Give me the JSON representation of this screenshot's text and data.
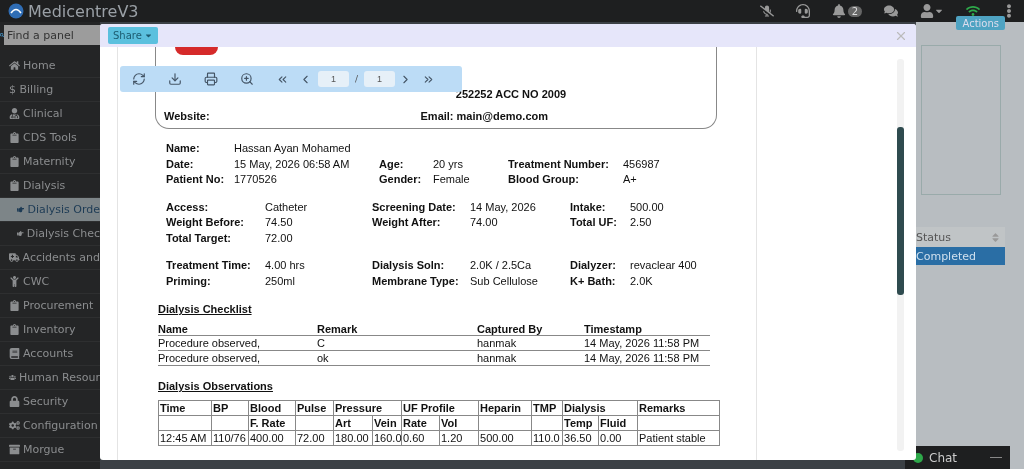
{
  "topbar": {
    "brand": "MedicentreV3",
    "notifications": "2"
  },
  "sidebar": {
    "search": {
      "placeholder": "Find a panel"
    },
    "items": [
      {
        "label": "Home",
        "selected": false
      },
      {
        "label": "$ Billing",
        "selected": false
      },
      {
        "label": "Clinical",
        "selected": false
      },
      {
        "label": "CDS Tools",
        "selected": false
      },
      {
        "label": "Maternity",
        "selected": false
      },
      {
        "label": "Dialysis",
        "selected": false,
        "expanded": true,
        "children": [
          {
            "label": "Dialysis Orde",
            "selected": true
          },
          {
            "label": "Dialysis Chec",
            "selected": false
          }
        ]
      },
      {
        "label": "Accidents and",
        "selected": false
      },
      {
        "label": "CWC",
        "selected": false
      },
      {
        "label": "Procurement",
        "selected": false
      },
      {
        "label": "Inventory",
        "selected": false
      },
      {
        "label": "Accounts",
        "selected": false
      },
      {
        "label": "Human Resour",
        "selected": false
      },
      {
        "label": "Security",
        "selected": false
      },
      {
        "label": "Configuration",
        "selected": false
      },
      {
        "label": "Morgue",
        "selected": false
      }
    ]
  },
  "background": {
    "actions": "Actions",
    "table": {
      "column": "Status",
      "cell": "Completed"
    }
  },
  "chat": {
    "label": "Chat",
    "online": true
  },
  "modal": {
    "share": "Share",
    "viewer": {
      "page": "1",
      "separator": "/",
      "pages": "1"
    },
    "document": {
      "header": {
        "contact": "252252 ACC NO 2009",
        "website": "Website:",
        "email": "Email: main@demo.com"
      },
      "sections": [
        [
          [
            [
              "Name:",
              "Hassan Ayan Mohamed"
            ]
          ],
          [
            [
              "Date:",
              "15 May, 2026 06:58 AM"
            ],
            [
              "Age:",
              "20 yrs"
            ],
            [
              "Treatment Number:",
              "456987"
            ]
          ],
          [
            [
              "Patient No:",
              "1770526"
            ],
            [
              "Gender:",
              "Female"
            ],
            [
              "Blood Group:",
              "A+"
            ]
          ]
        ],
        [
          [
            [
              "Access:",
              "Catheter"
            ],
            [
              "Screening Date:",
              "14 May, 2026"
            ],
            [
              "Intake:",
              "500.00"
            ]
          ],
          [
            [
              "Weight Before:",
              "74.50"
            ],
            [
              "Weight After:",
              "74.00"
            ],
            [
              "Total UF:",
              "2.50"
            ]
          ],
          [
            [
              "Total Target:",
              "72.00"
            ]
          ]
        ],
        [
          [
            [
              "Treatment Time:",
              "4.00 hrs"
            ],
            [
              "Dialysis Soln:",
              "2.0K / 2.5Ca"
            ],
            [
              "Dialyzer:",
              "revaclear 400"
            ]
          ],
          [
            [
              "Priming:",
              "250ml"
            ],
            [
              "Membrane Type:",
              "Sub Cellulose"
            ],
            [
              "K+ Bath:",
              "2.0K"
            ]
          ]
        ]
      ],
      "checklist": {
        "title": "Dialysis Checklist",
        "columns": [
          "Name",
          "Remark",
          "Captured By",
          "Timestamp"
        ],
        "rows": [
          [
            "Procedure observed,",
            "C",
            "hanmak",
            "14 May, 2026 11:58 PM"
          ],
          [
            "Procedure observed,",
            "ok",
            "hanmak",
            "14 May, 2026 11:58 PM"
          ]
        ]
      },
      "observations": {
        "title": "Dialysis Observations",
        "columns": [
          {
            "label": "Time"
          },
          {
            "label": "BP"
          },
          {
            "label": "Blood",
            "sub": [
              "F. Rate"
            ]
          },
          {
            "label": "Pulse"
          },
          {
            "label": "Pressure",
            "colspan": 2,
            "sub": [
              "Art",
              "Vein"
            ]
          },
          {
            "label": "UF Profile",
            "colspan": 2,
            "sub": [
              "Rate",
              "Vol"
            ]
          },
          {
            "label": "Heparin"
          },
          {
            "label": "TMP"
          },
          {
            "label": "Dialysis",
            "colspan": 2,
            "sub": [
              "Temp",
              "Fluid"
            ]
          },
          {
            "label": "Remarks"
          }
        ],
        "rows": [
          [
            "12:45 AM",
            "110/76",
            "400.00",
            "72.00",
            "180.00",
            "160.0",
            "0.60",
            "1.20",
            "500.00",
            "110.0",
            "36.50",
            "0.00",
            "Patient stable"
          ]
        ]
      }
    }
  }
}
